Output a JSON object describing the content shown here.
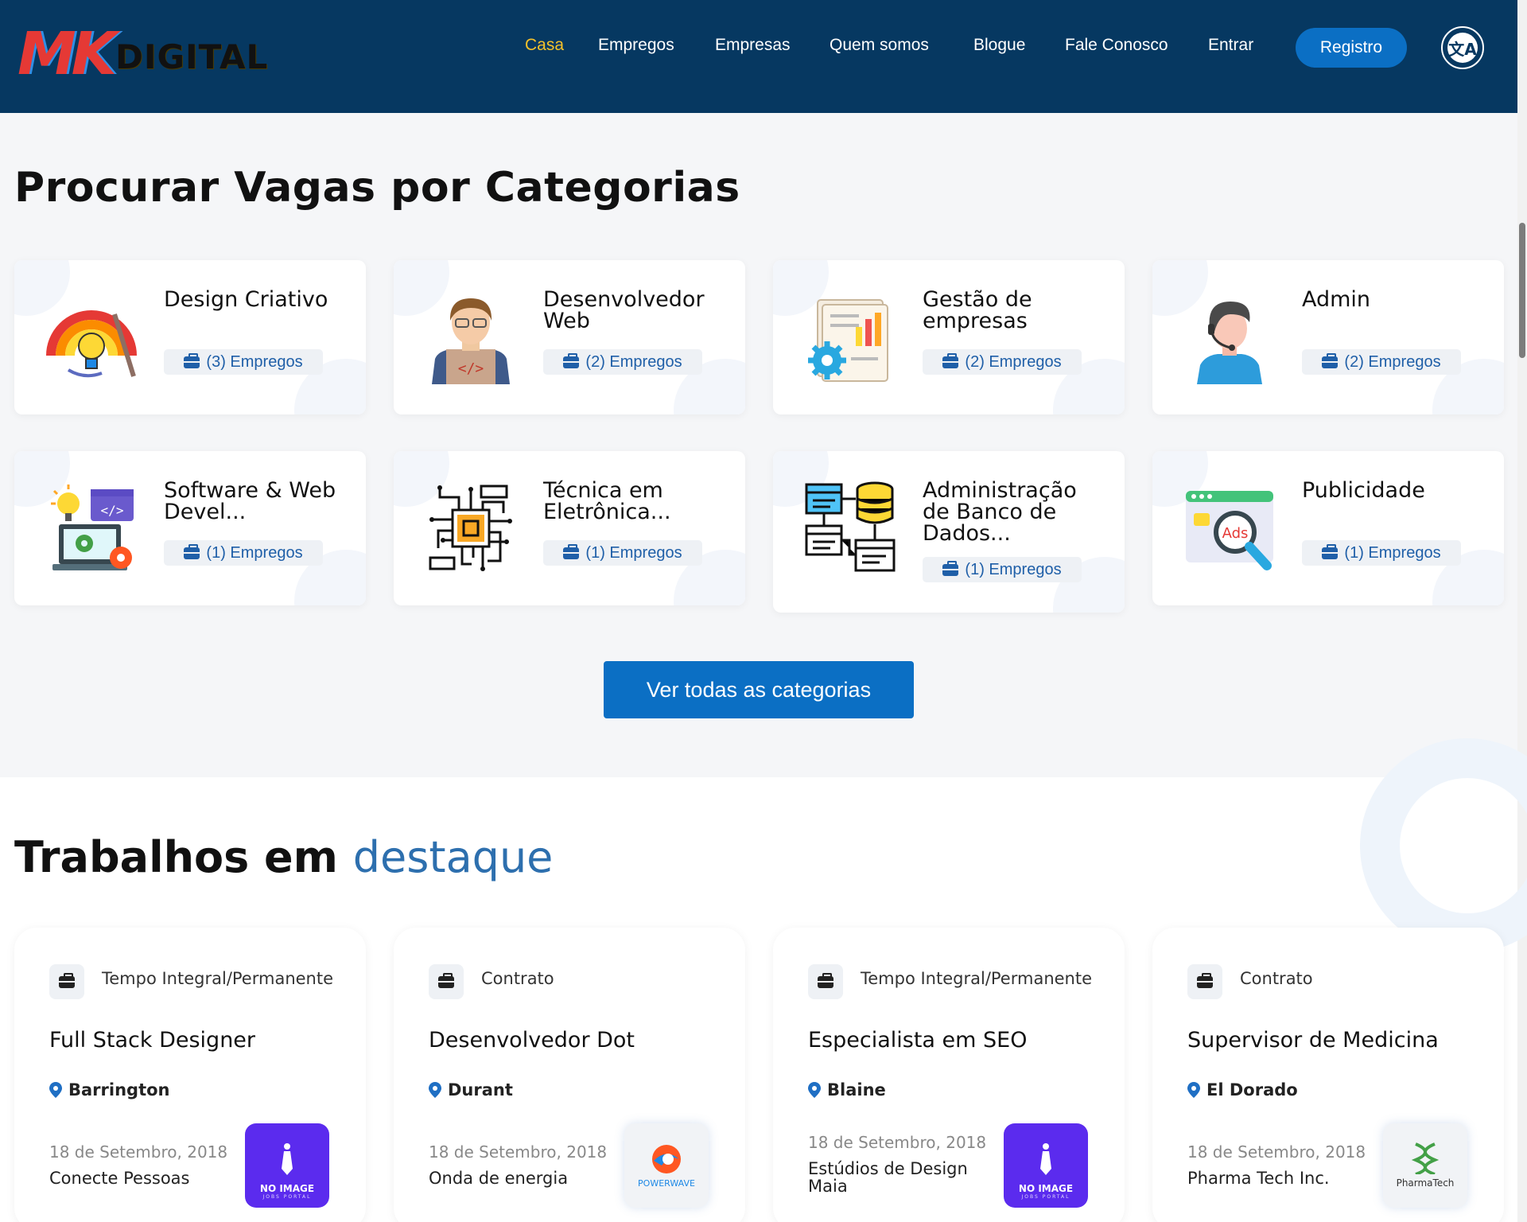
{
  "header": {
    "logo": {
      "mk": "MK",
      "digital": "DIGITAL"
    },
    "nav": [
      {
        "label": "Casa",
        "active": true
      },
      {
        "label": "Empregos",
        "active": false
      },
      {
        "label": "Empresas",
        "active": false
      },
      {
        "label": "Quem somos",
        "active": false
      },
      {
        "label": "Blogue",
        "active": false
      },
      {
        "label": "Fale Conosco",
        "active": false
      },
      {
        "label": "Entrar",
        "active": false
      }
    ],
    "register_label": "Registro",
    "language_icon": "translate-icon"
  },
  "categories": {
    "title": "Procurar Vagas por Categorias",
    "items": [
      {
        "name": "Design Criativo",
        "count": "(3) Empregos",
        "icon": "rainbow-lightbulb-icon"
      },
      {
        "name": "Desenvolvedor Web",
        "count": "(2) Empregos",
        "icon": "developer-avatar-icon"
      },
      {
        "name": "Gestão de empresas",
        "count": "(2) Empregos",
        "icon": "business-report-gear-icon"
      },
      {
        "name": "Admin",
        "count": "(2) Empregos",
        "icon": "support-agent-icon"
      },
      {
        "name": "Software & Web Devel...",
        "count": "(1) Empregos",
        "icon": "software-laptop-icon"
      },
      {
        "name": "Técnica em Eletrônica...",
        "count": "(1) Empregos",
        "icon": "microchip-icon"
      },
      {
        "name": "Administração de Banco de Dados...",
        "count": "(1) Empregos",
        "icon": "database-server-icon"
      },
      {
        "name": "Publicidade",
        "count": "(1) Empregos",
        "icon": "ads-magnifier-icon"
      }
    ],
    "view_all_label": "Ver todas as categorias"
  },
  "featured": {
    "title_main": "Trabalhos em",
    "title_accent": "destaque",
    "jobs": [
      {
        "type": "Tempo Integral/Permanente",
        "title": "Full Stack Designer",
        "location": "Barrington",
        "date": "18 de Setembro, 2018",
        "company": "Conecte Pessoas",
        "logo": "no-image"
      },
      {
        "type": "Contrato",
        "title": "Desenvolvedor Dot",
        "location": "Durant",
        "date": "18 de Setembro, 2018",
        "company": "Onda de energia",
        "logo": "powerwave"
      },
      {
        "type": "Tempo Integral/Permanente",
        "title": "Especialista em SEO",
        "location": "Blaine",
        "date": "18 de Setembro, 2018",
        "company": "Estúdios de Design Maia",
        "logo": "no-image"
      },
      {
        "type": "Contrato",
        "title": "Supervisor de Medicina",
        "location": "El Dorado",
        "date": "18 de Setembro, 2018",
        "company": "Pharma Tech Inc.",
        "logo": "pharmatech"
      }
    ],
    "logo_texts": {
      "noimage_line1": "NO IMAGE",
      "noimage_line2": "JOBS PORTAL",
      "powerwave": "POWERWAVE",
      "pharmatech": "PharmaTech"
    }
  },
  "colors": {
    "header_bg": "#063861",
    "nav_active": "#f4c12a",
    "primary_button": "#0b6fc4",
    "accent_text": "#2d6fae",
    "badge_text": "#1f5fa8"
  }
}
